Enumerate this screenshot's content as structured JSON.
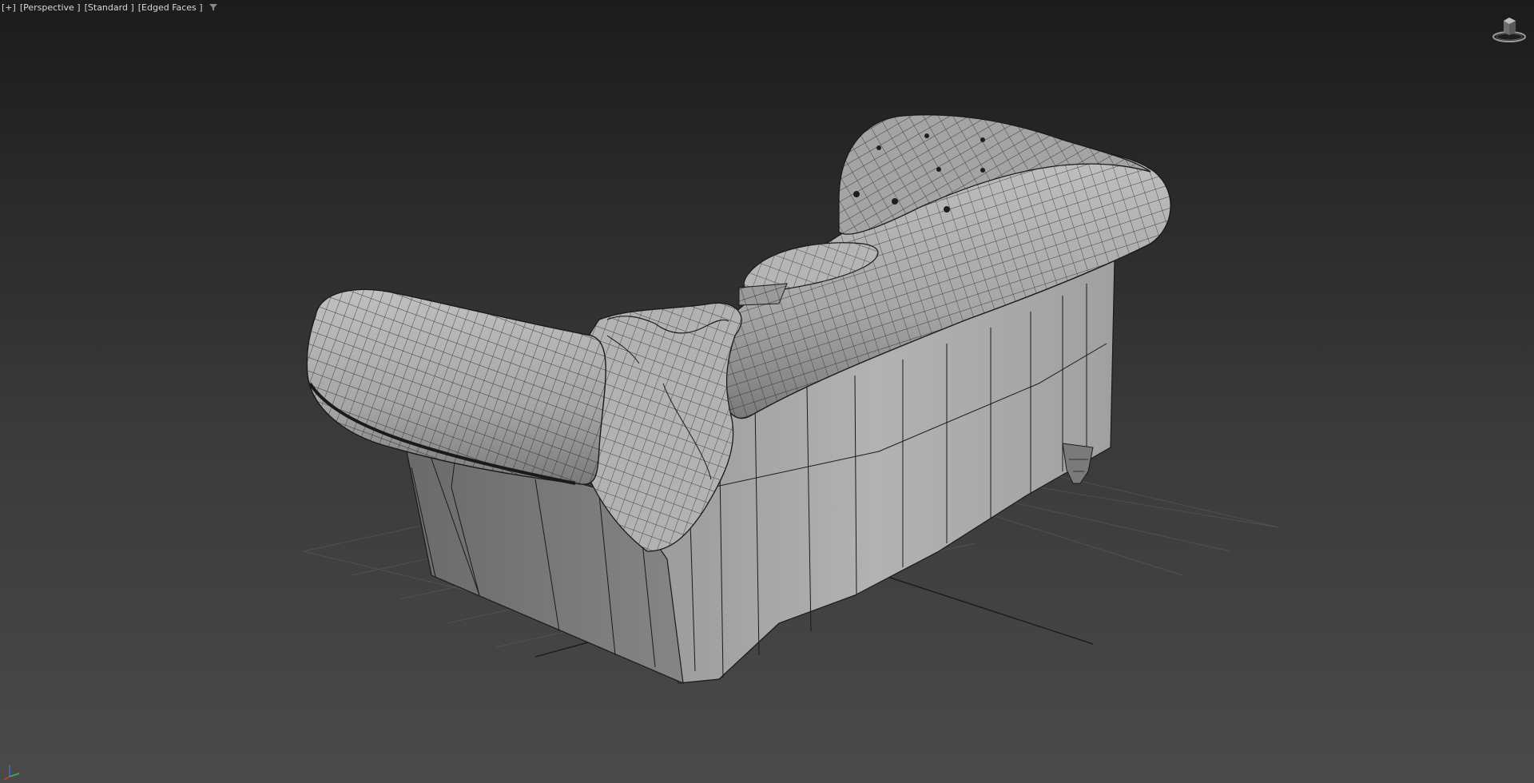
{
  "viewport": {
    "plus_menu": "[+]",
    "view_mode": "[Perspective ]",
    "shading_mode": "[Standard ]",
    "display_mode": "[Edged Faces ]",
    "filter_icon": "filter-icon",
    "viewcube_icon": "viewcube-icon",
    "tripod_icon": "axis-tripod-icon"
  },
  "colors": {
    "background_top": "#1b1b1b",
    "background_bottom": "#4a4a4a",
    "mesh_fill": "#a8a8a8",
    "mesh_shadow": "#6a6a6a",
    "wire": "#1a1a1a",
    "grid": "#5c5c5c",
    "label_text": "#d8d8d8"
  }
}
